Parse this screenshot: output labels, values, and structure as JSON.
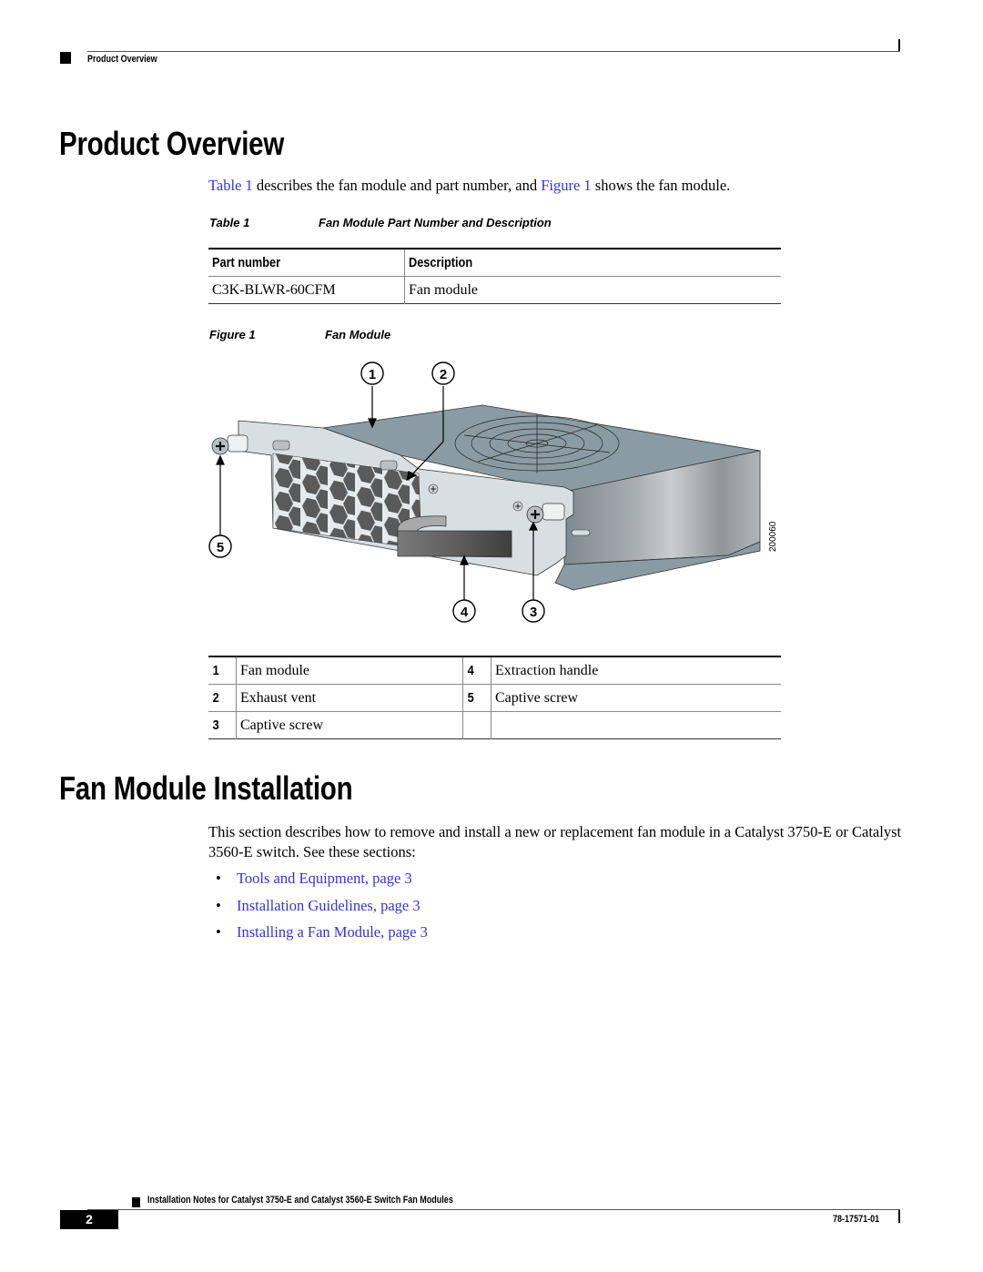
{
  "header": {
    "section_label": "Product Overview"
  },
  "product_overview": {
    "heading": "Product Overview",
    "intro": {
      "link_table": "Table 1",
      "text_mid": " describes the fan module and part number, and ",
      "link_figure": "Figure 1",
      "text_end": " shows the fan module."
    },
    "table_caption": {
      "label": "Table 1",
      "title": "Fan Module Part Number and Description"
    },
    "table": {
      "headers": [
        "Part number",
        "Description"
      ],
      "rows": [
        [
          "C3K-BLWR-60CFM",
          "Fan module"
        ]
      ]
    },
    "figure_caption": {
      "label": "Figure 1",
      "title": "Fan Module"
    },
    "figure": {
      "callouts": [
        "1",
        "2",
        "3",
        "4",
        "5"
      ],
      "art_id": "200060"
    },
    "legend": {
      "rows": [
        {
          "num_a": "1",
          "label_a": "Fan module",
          "num_b": "4",
          "label_b": "Extraction handle"
        },
        {
          "num_a": "2",
          "label_a": "Exhaust vent",
          "num_b": "5",
          "label_b": "Captive screw"
        },
        {
          "num_a": "3",
          "label_a": "Captive screw",
          "num_b": "",
          "label_b": ""
        }
      ]
    }
  },
  "installation": {
    "heading": "Fan Module Installation",
    "paragraph": "This section describes how to remove and install a new or replacement fan module in a Catalyst 3750-E or Catalyst 3560-E switch. See these sections:",
    "links": [
      "Tools and Equipment, page 3",
      "Installation Guidelines, page 3",
      "Installing a Fan Module, page 3"
    ],
    "bullet": "•"
  },
  "footer": {
    "doc_title": "Installation Notes for Catalyst 3750-E and Catalyst 3560-E Switch Fan Modules",
    "page_number": "2",
    "doc_number": "78-17571-01"
  },
  "colors": {
    "link": "#3333dd",
    "module_top": "#8a9ba3",
    "bezel": "#d8dfe2",
    "vent": "#5a5a5a"
  }
}
